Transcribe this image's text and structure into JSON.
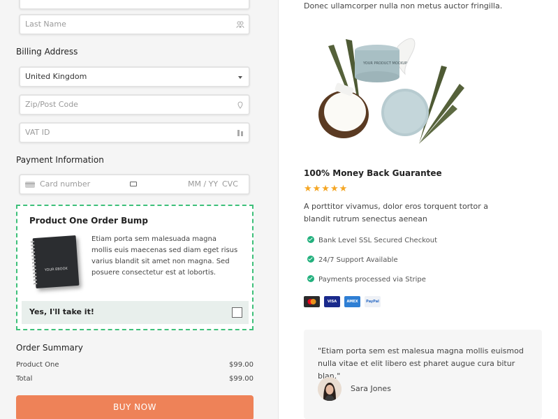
{
  "form": {
    "last_name_placeholder": "Last Name",
    "billing_title": "Billing Address",
    "country_value": "United Kingdom",
    "zip_placeholder": "Zip/Post Code",
    "vat_placeholder": "VAT ID",
    "payment_title": "Payment Information",
    "card_placeholder": "Card number",
    "expiry_placeholder": "MM / YY",
    "cvc_placeholder": "CVC"
  },
  "bump": {
    "title": "Product One Order Bump",
    "ebook_text": "YOUR EBOOK",
    "description": "Etiam porta sem malesuada magna mollis euis maecenas sed diam eget risus varius blandit sit amet non magna. Sed posuere consectetur est at lobortis.",
    "accept_label": "Yes, I'll take it!"
  },
  "summary": {
    "title": "Order Summary",
    "rows": [
      {
        "label": "Product One",
        "value": "$99.00"
      },
      {
        "label": "Total",
        "value": "$99.00"
      }
    ]
  },
  "buy_label": "BUY NOW",
  "product": {
    "top_text": "Donec ullamcorper nulla non metus auctor fringilla.",
    "jar_label": "YOUR PRODUCT MOCKUP",
    "guarantee_title": "100% Money Back Guarantee",
    "stars": "★★★★★",
    "description": "A porttitor vivamus, dolor eros torquent tortor a blandit rutrum senectus aenean",
    "features": [
      "Bank Level SSL Secured Checkout",
      "24/7 Support Available",
      "Payments processed via Stripe"
    ],
    "payment_methods": [
      {
        "name": "mastercard",
        "label": "",
        "color": "#2b2b2b"
      },
      {
        "name": "visa",
        "label": "VISA",
        "color": "#1a2a8c"
      },
      {
        "name": "amex",
        "label": "AMEX",
        "color": "#2f7fd4"
      },
      {
        "name": "paypal",
        "label": "PayPal",
        "color": "#eef1f6"
      }
    ]
  },
  "testimonial": {
    "quote": "\"Etiam porta sem est malesua magna mollis euismod nulla vitae et elit libero est pharet augue cura bitur blan.\"",
    "author": "Sara Jones"
  },
  "colors": {
    "accent": "#ee8258",
    "success": "#22b07d",
    "bump_border": "#3ec07a",
    "star": "#f5a623"
  }
}
